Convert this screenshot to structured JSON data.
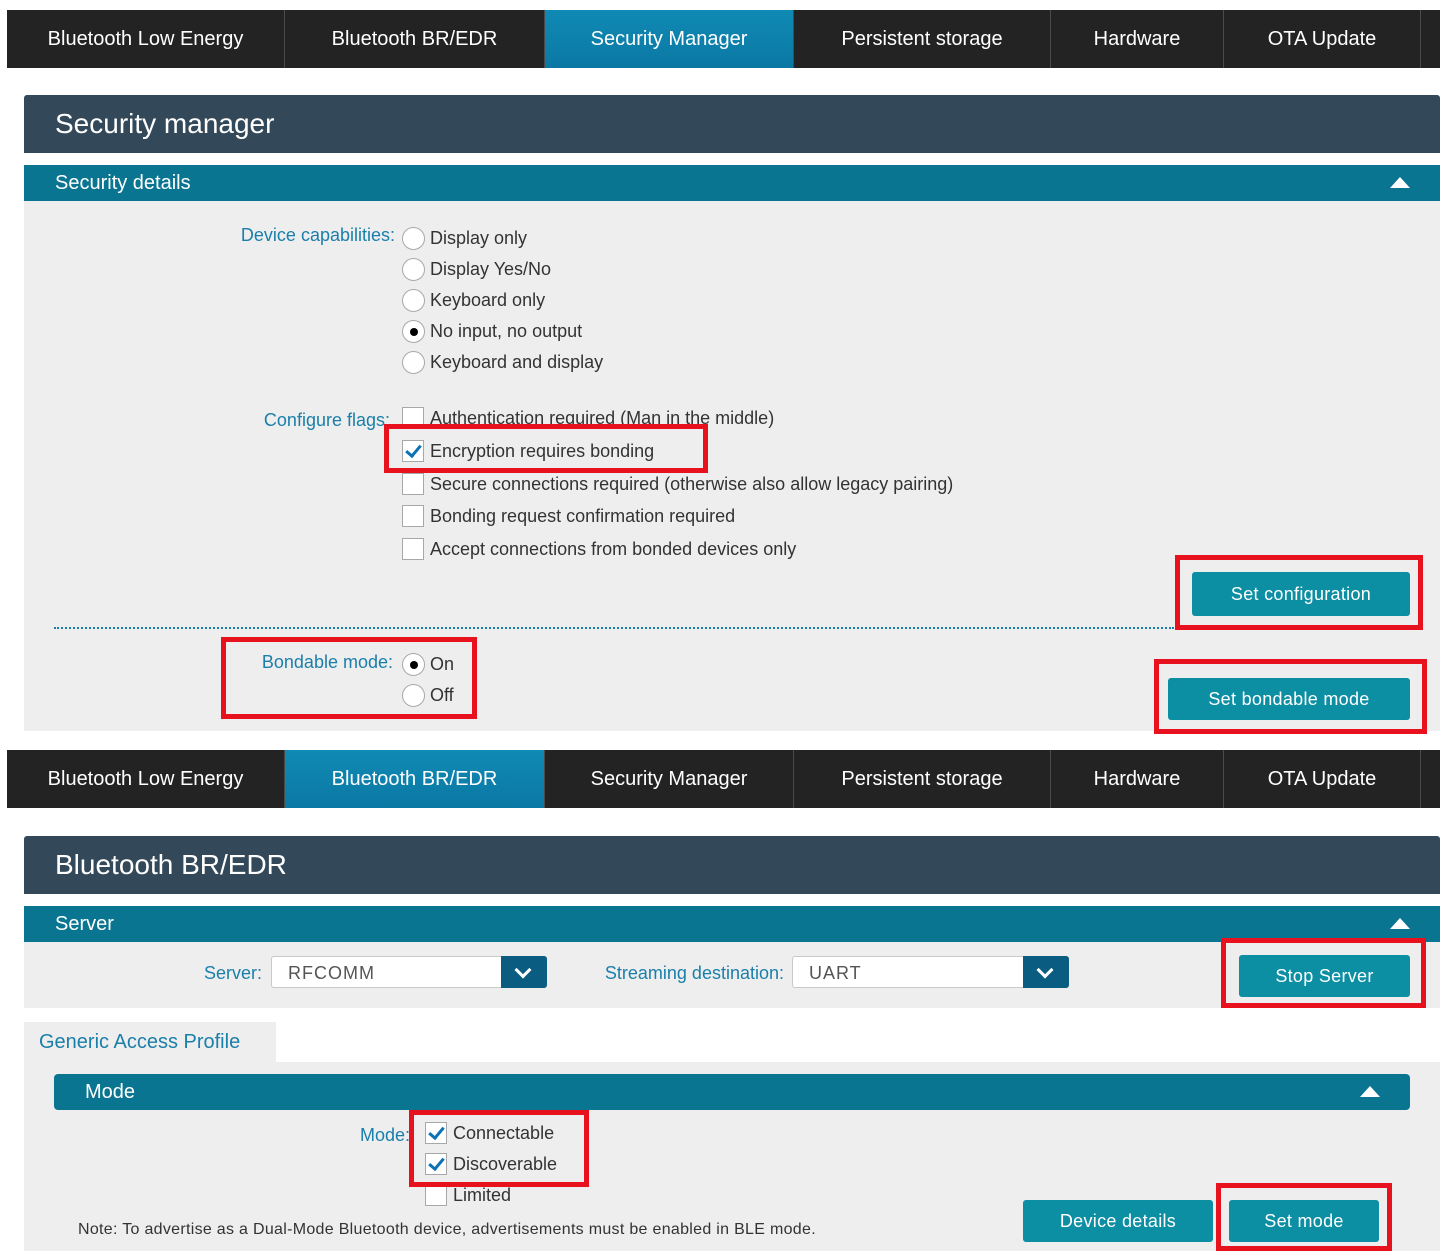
{
  "top_tabs": [
    "Bluetooth Low Energy",
    "Bluetooth BR/EDR",
    "Security Manager",
    "Persistent storage",
    "Hardware",
    "OTA Update"
  ],
  "bottom_tabs": [
    "Bluetooth Low Energy",
    "Bluetooth BR/EDR",
    "Security Manager",
    "Persistent storage",
    "Hardware",
    "OTA Update"
  ],
  "security": {
    "title": "Security manager",
    "section": "Security details",
    "capabilities_label": "Device capabilities:",
    "capabilities": [
      "Display only",
      "Display Yes/No",
      "Keyboard only",
      "No input, no output",
      "Keyboard and display"
    ],
    "capabilities_selected": "No input, no output",
    "flags_label": "Configure flags:",
    "flags": [
      {
        "label": "Authentication required (Man in the middle)",
        "checked": false
      },
      {
        "label": "Encryption requires bonding",
        "checked": true
      },
      {
        "label": "Secure connections required (otherwise also allow legacy pairing)",
        "checked": false
      },
      {
        "label": "Bonding request confirmation required",
        "checked": false
      },
      {
        "label": "Accept connections from bonded devices only",
        "checked": false
      }
    ],
    "set_configuration": "Set configuration",
    "bondable_label": "Bondable mode:",
    "bondable_on": "On",
    "bondable_off": "Off",
    "bondable_selected": "On",
    "set_bondable": "Set bondable mode"
  },
  "bredr": {
    "title": "Bluetooth BR/EDR",
    "server_section": "Server",
    "server_label": "Server:",
    "server_value": "RFCOMM",
    "streaming_label": "Streaming destination:",
    "streaming_value": "UART",
    "stop_server": "Stop Server",
    "gap_tab": "Generic Access Profile",
    "mode_section": "Mode",
    "mode_label": "Mode:",
    "modes": [
      {
        "label": "Connectable",
        "checked": true
      },
      {
        "label": "Discoverable",
        "checked": true
      },
      {
        "label": "Limited",
        "checked": false
      }
    ],
    "note": "Note: To advertise as a Dual-Mode Bluetooth device, advertisements must be enabled in BLE mode.",
    "device_details": "Device details",
    "set_mode": "Set mode"
  },
  "colors": {
    "tab_bg": "#232323",
    "tab_active": "#0b7fab",
    "title_bg": "#33495a",
    "section_bg": "#0a7591",
    "button": "#0c8ea3",
    "label": "#1a7faa",
    "highlight": "#e8121e"
  },
  "active_top_tab": "Security Manager",
  "active_bottom_tab": "Bluetooth BR/EDR"
}
